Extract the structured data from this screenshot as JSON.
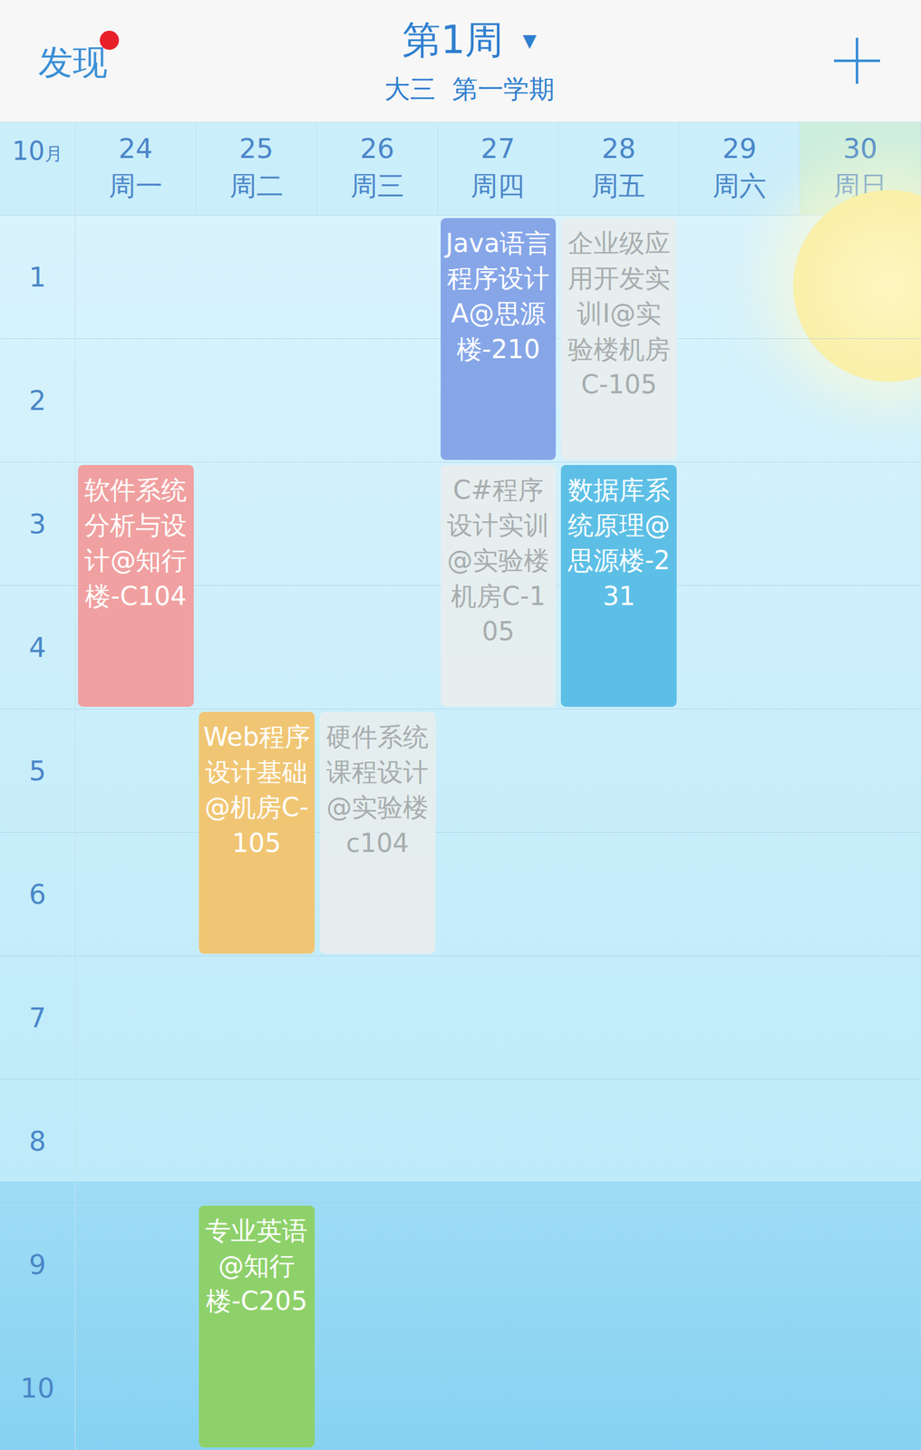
{
  "header": {
    "discover": "发现",
    "has_notification": true,
    "week": "第1周",
    "dropdown": "▼",
    "term": "大三  第一学期"
  },
  "month": {
    "number": "10",
    "unit": "月"
  },
  "days": [
    {
      "date": "24",
      "weekday": "周一",
      "selected": false
    },
    {
      "date": "25",
      "weekday": "周二",
      "selected": false
    },
    {
      "date": "26",
      "weekday": "周三",
      "selected": false
    },
    {
      "date": "27",
      "weekday": "周四",
      "selected": false
    },
    {
      "date": "28",
      "weekday": "周五",
      "selected": false
    },
    {
      "date": "29",
      "weekday": "周六",
      "selected": false
    },
    {
      "date": "30",
      "weekday": "周日",
      "selected": true
    }
  ],
  "periods": [
    "1",
    "2",
    "3",
    "4",
    "5",
    "6",
    "7",
    "8",
    "9",
    "10"
  ],
  "courses": [
    {
      "name": "Java语言程序设计A@思源楼-210",
      "day": 4,
      "start": 1,
      "span": 2,
      "current": true,
      "color": "#86a6e8"
    },
    {
      "name": "企业级应用开发实训I@实验楼机房C-105",
      "day": 5,
      "start": 1,
      "span": 2,
      "current": false,
      "color": "#e8eeee"
    },
    {
      "name": "软件系统分析与设计@知行楼-C104",
      "day": 1,
      "start": 3,
      "span": 2,
      "current": true,
      "color": "#f0a0a0"
    },
    {
      "name": "C#程序设计实训@实验楼机房C-105",
      "day": 4,
      "start": 3,
      "span": 2,
      "current": false,
      "color": "#e8eeee"
    },
    {
      "name": "数据库系统原理@思源楼-231",
      "day": 5,
      "start": 3,
      "span": 2,
      "current": true,
      "color": "#5dbfe6"
    },
    {
      "name": "Web程序设计基础@机房C-105",
      "day": 2,
      "start": 5,
      "span": 2,
      "current": true,
      "color": "#f0c674"
    },
    {
      "name": "硬件系统课程设计@实验楼c104",
      "day": 3,
      "start": 5,
      "span": 2,
      "current": false,
      "color": "#e8eeee"
    },
    {
      "name": "专业英语@知行楼-C205",
      "day": 2,
      "start": 9,
      "span": 2,
      "current": true,
      "color": "#8ed16a"
    }
  ]
}
